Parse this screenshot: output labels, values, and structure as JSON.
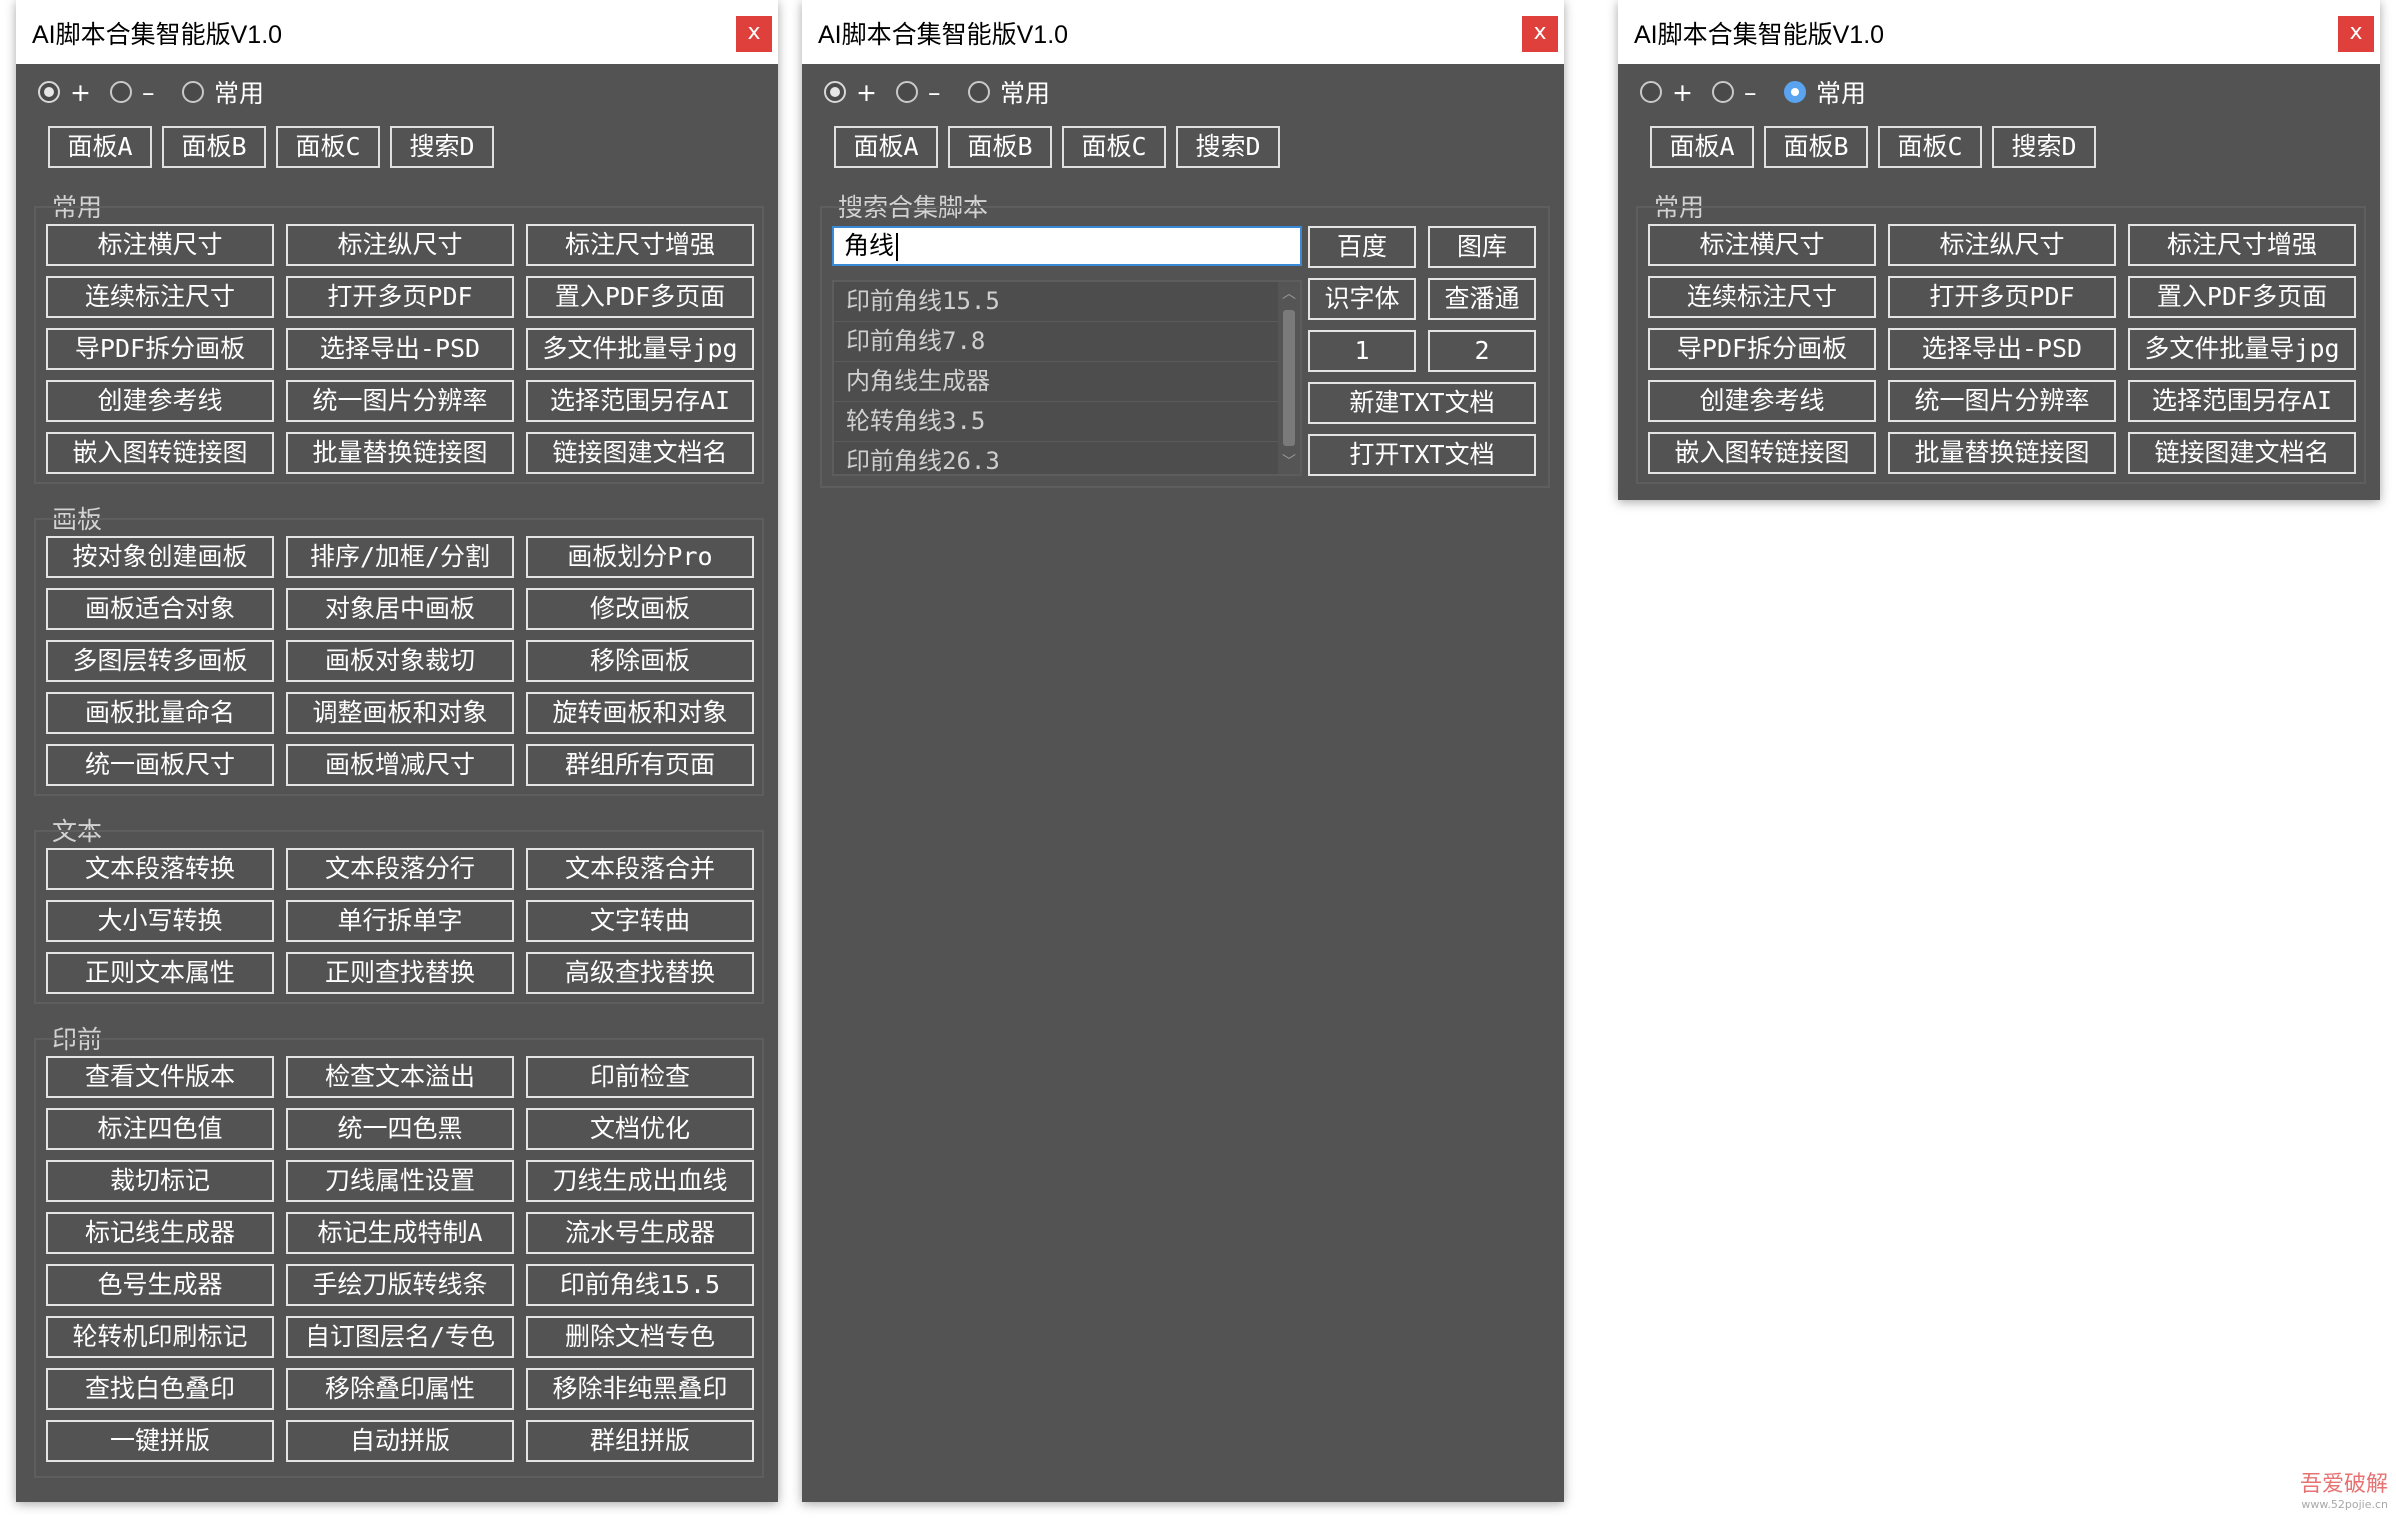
{
  "window_title": "AI脚本合集智能版V1.0",
  "close_label": "x",
  "radio_plus": "+",
  "radio_minus": "–",
  "radio_common": "常用",
  "tabs": [
    "面板A",
    "面板B",
    "面板C",
    "搜索D"
  ],
  "sections": {
    "common": {
      "label": "常用",
      "buttons": [
        "标注横尺寸",
        "标注纵尺寸",
        "标注尺寸增强",
        "连续标注尺寸",
        "打开多页PDF",
        "置入PDF多页面",
        "导PDF拆分画板",
        "选择导出-PSD",
        "多文件批量导jpg",
        "创建参考线",
        "统一图片分辨率",
        "选择范围另存AI",
        "嵌入图转链接图",
        "批量替换链接图",
        "链接图建文档名"
      ]
    },
    "artboard": {
      "label": "画板",
      "buttons": [
        "按对象创建画板",
        "排序/加框/分割",
        "画板划分Pro",
        "画板适合对象",
        "对象居中画板",
        "修改画板",
        "多图层转多画板",
        "画板对象裁切",
        "移除画板",
        "画板批量命名",
        "调整画板和对象",
        "旋转画板和对象",
        "统一画板尺寸",
        "画板增减尺寸",
        "群组所有页面"
      ]
    },
    "text": {
      "label": "文本",
      "buttons": [
        "文本段落转换",
        "文本段落分行",
        "文本段落合并",
        "大小写转换",
        "单行拆单字",
        "文字转曲",
        "正则文本属性",
        "正则查找替换",
        "高级查找替换"
      ]
    },
    "prepress": {
      "label": "印前",
      "buttons": [
        "查看文件版本",
        "检查文本溢出",
        "印前检查",
        "标注四色值",
        "统一四色黑",
        "文档优化",
        "裁切标记",
        "刀线属性设置",
        "刀线生成出血线",
        "标记线生成器",
        "标记生成特制A",
        "流水号生成器",
        "色号生成器",
        "手绘刀版转线条",
        "印前角线15.5",
        "轮转机印刷标记",
        "自订图层名/专色",
        "删除文档专色",
        "查找白色叠印",
        "移除叠印属性",
        "移除非纯黑叠印",
        "一键拼版",
        "自动拼版",
        "群组拼版"
      ]
    }
  },
  "search": {
    "label": "搜索合集脚本",
    "input_value": "角线",
    "results": [
      "印前角线15.5",
      "印前角线7.8",
      "内角线生成器",
      "轮转角线3.5",
      "印前角线26.3"
    ],
    "side_buttons": [
      "百度",
      "图库",
      "识字体",
      "查潘通",
      "1",
      "2",
      "新建TXT文档",
      "打开TXT文档"
    ]
  },
  "watermark": "吾爱破解",
  "watermark_sub": "www.52pojie.cn"
}
